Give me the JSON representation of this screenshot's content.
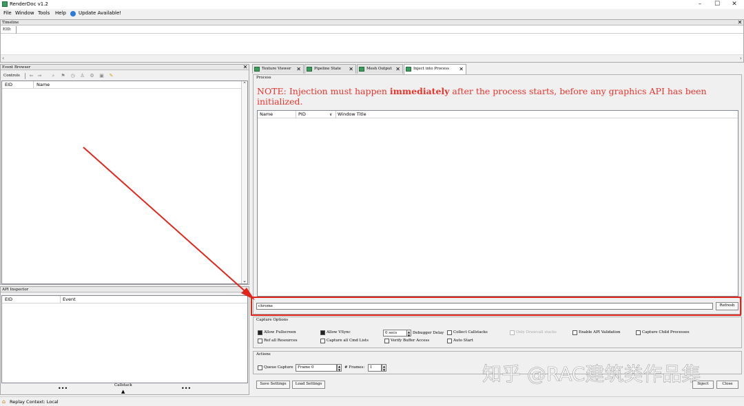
{
  "window": {
    "title": "RenderDoc v1.2",
    "controls": [
      "–",
      "☐",
      "✕"
    ]
  },
  "menu": {
    "file": "File",
    "window": "Window",
    "tools": "Tools",
    "help": "Help",
    "update": "Update Available!"
  },
  "timeline": {
    "title": "Timeline",
    "eid_label": "EID:"
  },
  "event_browser": {
    "title": "Event Browser",
    "controls_label": "Controls",
    "columns": [
      "EID",
      "Name"
    ]
  },
  "api_inspector": {
    "title": "API Inspector",
    "columns": [
      "EID",
      "Event"
    ],
    "callstack_label": "Callstack",
    "dots": "•••"
  },
  "tabs": [
    {
      "label": "Texture Viewer"
    },
    {
      "label": "Pipeline State"
    },
    {
      "label": "Mesh Output"
    },
    {
      "label": "Inject into Process"
    }
  ],
  "inject": {
    "process_group": "Process",
    "note_prefix": "NOTE: Injection must happen ",
    "note_bold": "immediately",
    "note_suffix": " after the process starts, before any graphics API has been initialized.",
    "columns": [
      "Name",
      "PID",
      "Window Title"
    ],
    "filter_value": "chrome",
    "refresh_label": "Refresh",
    "capture_options_title": "Capture Options",
    "options": {
      "allow_fullscreen": "Allow Fullscreen",
      "allow_vsync": "Allow VSync",
      "delay_value": "0 secs",
      "debugger_delay": "Debugger Delay",
      "collect_callstacks": "Collect Callstacks",
      "only_drawcall": "Only Drawcall stacks",
      "enable_api_validation": "Enable API Validation",
      "capture_child": "Capture Child Processes",
      "ref_all_resources": "Ref all Resources",
      "capture_cmd_lists": "Capture all Cmd Lists",
      "verify_buffer": "Verify Buffer Access",
      "auto_start": "Auto Start"
    },
    "actions_title": "Actions",
    "queue_capture": "Queue Capture",
    "frame_value": "Frame 0",
    "frames_label": "# Frames:",
    "frames_value": "1",
    "save_settings": "Save Settings",
    "load_settings": "Load Settings",
    "inject_label": "Inject",
    "close_label": "Close"
  },
  "status": {
    "text": "Replay Context: Local"
  },
  "watermark": "知乎 @RAC建筑类作品集",
  "colors": {
    "accent_red": "#e0251b",
    "note_red": "#e8352c",
    "tab_icon_green": "#3a9d5d"
  }
}
